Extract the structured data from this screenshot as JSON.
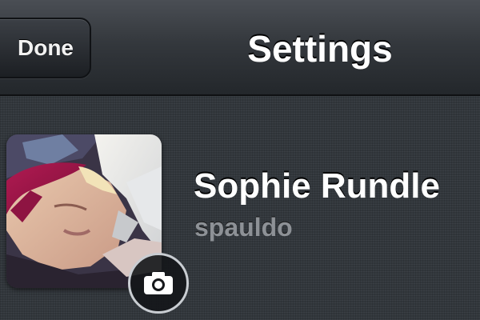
{
  "navbar": {
    "title": "Settings",
    "done_label": "Done"
  },
  "profile": {
    "name": "Sophie Rundle",
    "username": "spauldo",
    "avatar_icon": "profile-photo",
    "camera_icon": "camera-icon"
  },
  "colors": {
    "navbar_top": "#4a4e54",
    "navbar_bottom": "#23272b",
    "background": "#32373c",
    "username": "#8d9196"
  }
}
